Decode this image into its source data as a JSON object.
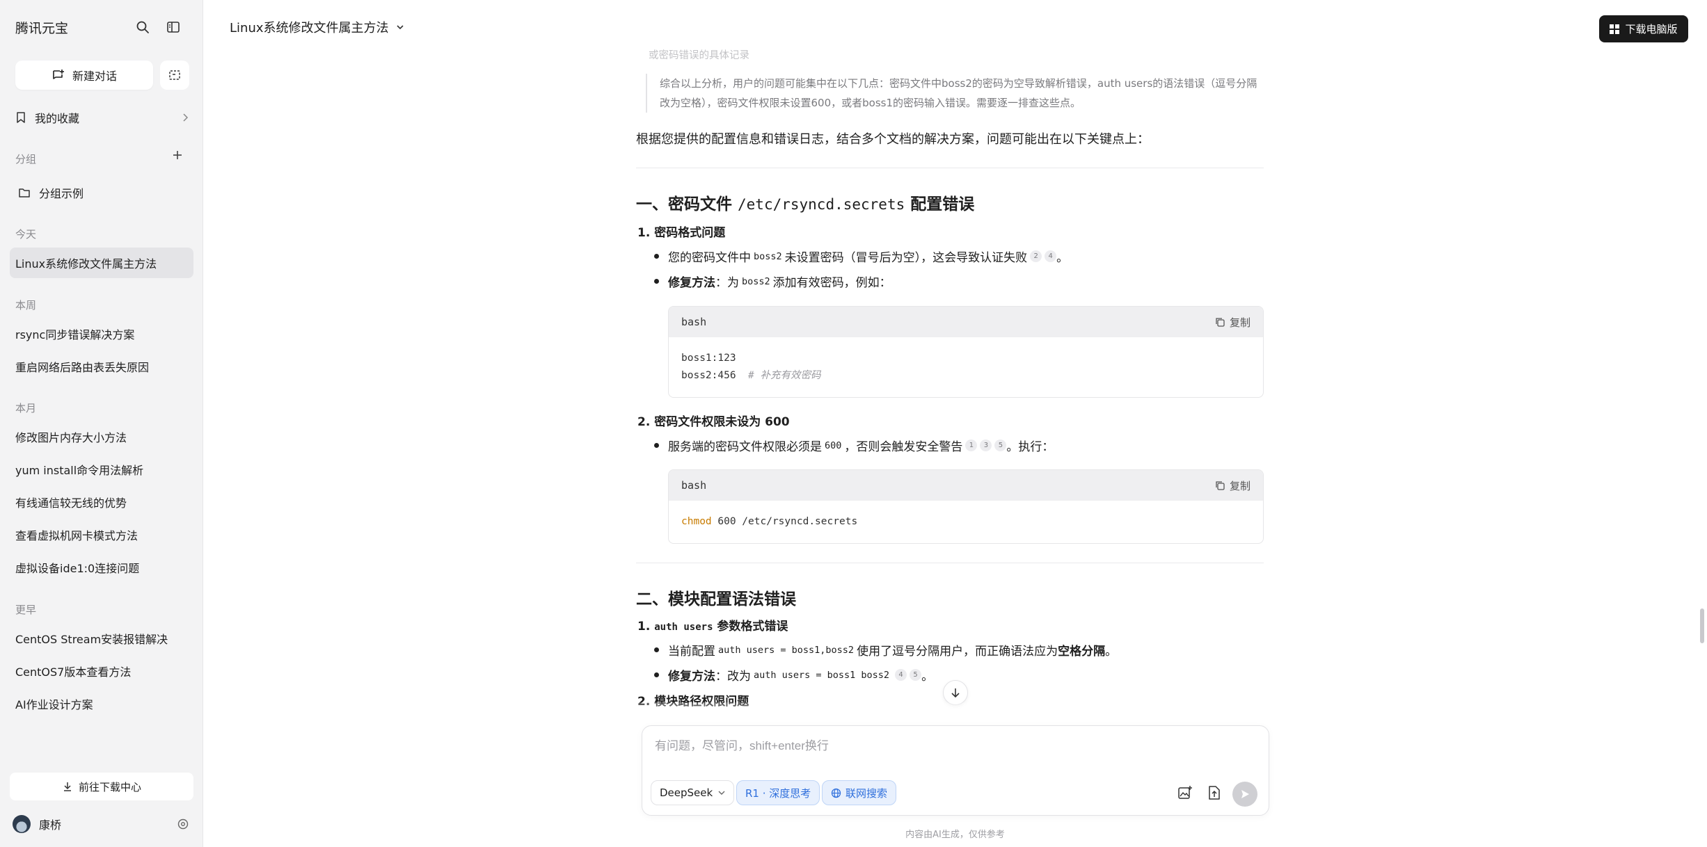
{
  "sidebar": {
    "brand": "腾讯元宝",
    "new_chat_label": "新建对话",
    "favorites_label": "我的收藏",
    "groups_label": "分组",
    "group_example": "分组示例",
    "sections": {
      "today": "今天",
      "this_week": "本周",
      "this_month": "本月",
      "earlier": "更早"
    },
    "today_items": [
      "Linux系统修改文件属主方法"
    ],
    "week_items": [
      "rsync同步错误解决方案",
      "重启网络后路由表丢失原因"
    ],
    "month_items": [
      "修改图片内存大小方法",
      "yum install命令用法解析",
      "有线通信较无线的优势",
      "查看虚拟机网卡模式方法",
      "虚拟设备ide1:0连接问题"
    ],
    "earlier_items": [
      "CentOS Stream安装报错解决",
      "CentOS7版本查看方法",
      "AI作业设计方案"
    ],
    "download_center": "前往下载中心",
    "user_name": "康桥"
  },
  "header": {
    "title": "Linux系统修改文件属主方法",
    "download_app": "下载电脑版"
  },
  "content": {
    "faded_top": "或密码错误的具体记录",
    "quote": "综合以上分析，用户的问题可能集中在以下几点：密码文件中boss2的密码为空导致解析错误，auth users的语法错误（逗号分隔改为空格），密码文件权限未设置600，或者boss1的密码输入错误。需要逐一排查这些点。",
    "intro": "根据您提供的配置信息和错误日志，结合多个文档的解决方案，问题可能出在以下关键点上：",
    "section1": {
      "prefix": "一、密码文件 ",
      "code": "/etc/rsyncd.secrets",
      "suffix": " 配置错误",
      "sub1": "1. 密码格式问题",
      "b1_a": "您的密码文件中 ",
      "b1_code": "boss2",
      "b1_b": " 未设置密码（冒号后为空），这会导致认证失败",
      "b1_cites": [
        "2",
        "4"
      ],
      "b1_end": "。",
      "b2_bold": "修复方法",
      "b2_a": "：为 ",
      "b2_code": "boss2",
      "b2_b": " 添加有效密码，例如：",
      "code1_lang": "bash",
      "code1_line1": "boss1:123",
      "code1_line2": "boss2:456",
      "code1_comment": "# 补充有效密码",
      "sub2": "2. 密码文件权限未设为 600",
      "b3_a": "服务端的密码文件权限必须是 ",
      "b3_code": "600",
      "b3_b": "，否则会触发安全警告",
      "b3_cites": [
        "1",
        "3",
        "5"
      ],
      "b3_end": "。执行：",
      "code2_lang": "bash",
      "code2_kw": "chmod",
      "code2_rest": " 600 /etc/rsyncd.secrets"
    },
    "section2": {
      "title": "二、模块配置语法错误",
      "sub1_code": "auth users",
      "sub1_text": " 参数格式错误",
      "b1_a": "当前配置 ",
      "b1_code": "auth users = boss1,boss2",
      "b1_b": " 使用了逗号分隔用户，而正确语法应为 ",
      "b1_bold": "空格分隔",
      "b1_end": "。",
      "b2_bold": "修复方法",
      "b2_a": "：改为 ",
      "b2_code": "auth users = boss1 boss2",
      "b2_cites": [
        "4",
        "5"
      ],
      "b2_end": "。",
      "sub2": "2. 模块路径权限问题"
    },
    "copy_label": "复制"
  },
  "composer": {
    "placeholder": "有问题，尽管问，shift+enter换行",
    "model": "DeepSeek",
    "deep_think": "R1 · 深度思考",
    "web_search": "联网搜索"
  },
  "footer": {
    "disclaimer": "内容由AI生成，仅供参考"
  },
  "colors": {
    "sidebar_bg": "#f3f3f4",
    "active_item": "#e4e4e7",
    "chip_blue": "#2f6fdc",
    "keyword": "#c77b00"
  }
}
